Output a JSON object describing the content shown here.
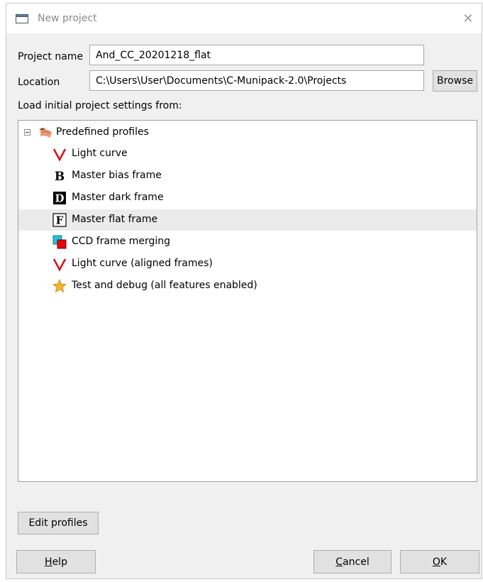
{
  "window": {
    "title": "New project",
    "close_icon": "close-icon"
  },
  "form": {
    "project_name_label": "Project name",
    "project_name_value": "And_CC_20201218_flat",
    "location_label": "Location",
    "location_value": "C:\\Users\\User\\Documents\\C-Munipack-2.0\\Projects",
    "browse_label": "Browse",
    "load_label": "Load initial project settings from:"
  },
  "tree": {
    "root_label": "Predefined profiles",
    "items": [
      {
        "label": "Light curve",
        "icon": "light-curve-icon"
      },
      {
        "label": "Master bias frame",
        "icon": "bias-icon"
      },
      {
        "label": "Master dark frame",
        "icon": "dark-icon"
      },
      {
        "label": "Master flat frame",
        "icon": "flat-icon",
        "selected": true
      },
      {
        "label": "CCD frame merging",
        "icon": "merging-icon"
      },
      {
        "label": "Light curve (aligned frames)",
        "icon": "light-curve-icon"
      },
      {
        "label": "Test and debug (all features enabled)",
        "icon": "star-icon"
      }
    ]
  },
  "buttons": {
    "edit_profiles": "Edit profiles",
    "help_prefix": "",
    "help_mnemonic": "H",
    "help_rest": "elp",
    "cancel_mnemonic": "C",
    "cancel_rest": "ancel",
    "ok_mnemonic": "O",
    "ok_rest": "K"
  },
  "colors": {
    "window_bg": "#f0f0f0",
    "selected_row": "#ebebeb",
    "light_curve_red": "#d9141b",
    "merge_cyan": "#1fc6d6",
    "merge_red": "#e30613",
    "star_gold": "#f2b62c"
  }
}
